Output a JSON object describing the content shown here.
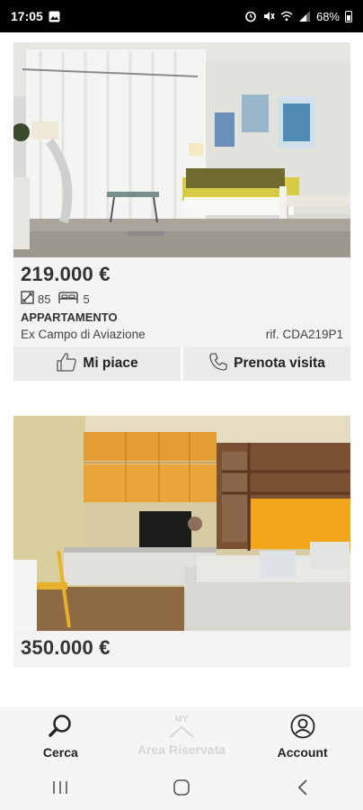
{
  "status_bar": {
    "time": "17:05",
    "battery": "68%"
  },
  "listings": [
    {
      "price": "219.000 €",
      "area": "85",
      "beds": "5",
      "type": "APPARTAMENTO",
      "location": "Ex Campo di Aviazione",
      "reference": "rif. CDA219P1",
      "like_label": "Mi piace",
      "visit_label": "Prenota visita"
    },
    {
      "price": "350.000 €"
    }
  ],
  "tabs": [
    {
      "label": "Cerca",
      "icon": "search-icon"
    },
    {
      "label": "Area Riservata",
      "icon": "my-area-icon",
      "badge": "MY"
    },
    {
      "label": "Account",
      "icon": "account-icon"
    }
  ],
  "nav": [
    "recent-apps-icon",
    "home-icon",
    "back-icon"
  ]
}
